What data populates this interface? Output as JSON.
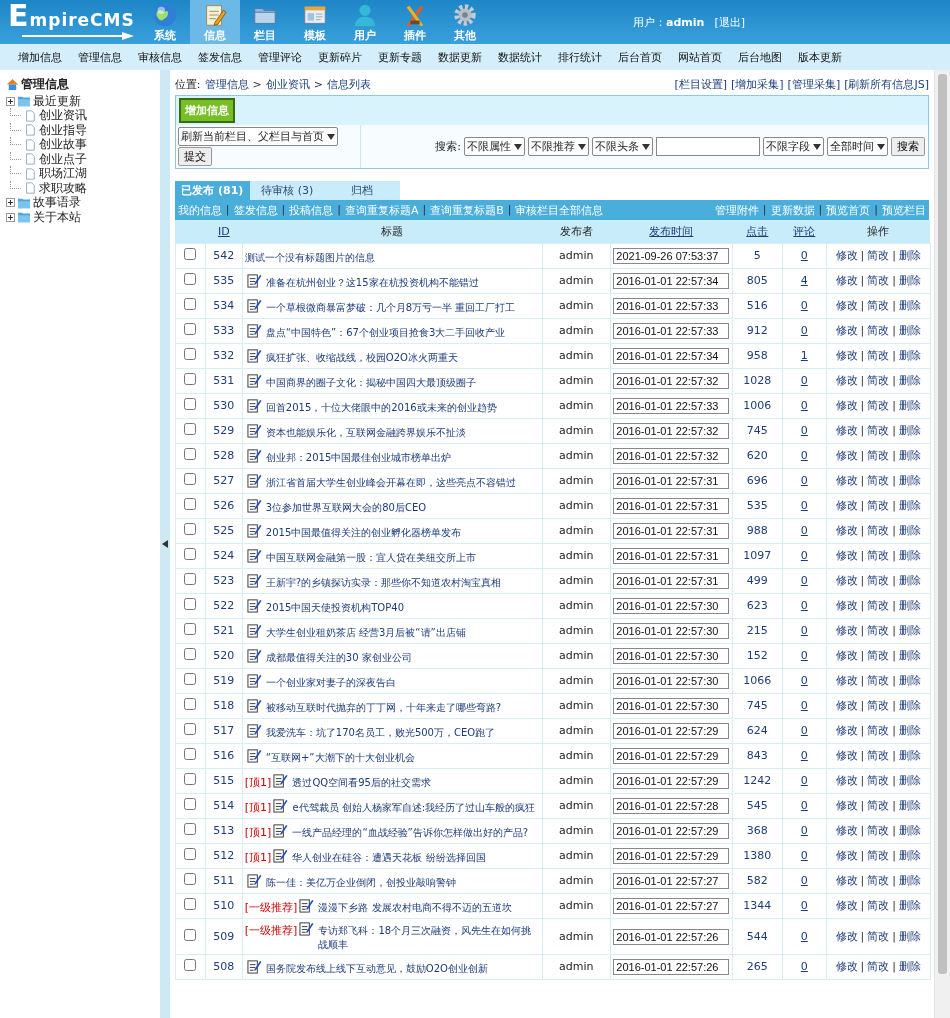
{
  "header": {
    "logo": "EmpireCMS",
    "nav": [
      {
        "kind": "globe",
        "label": "系统",
        "selected": false
      },
      {
        "kind": "notepad",
        "label": "信息",
        "selected": true
      },
      {
        "kind": "folder",
        "label": "栏目",
        "selected": false
      },
      {
        "kind": "window",
        "label": "模板",
        "selected": false
      },
      {
        "kind": "person",
        "label": "用户",
        "selected": false
      },
      {
        "kind": "tools",
        "label": "插件",
        "selected": false
      },
      {
        "kind": "gear",
        "label": "其他",
        "selected": false
      }
    ],
    "user_label": "用户：",
    "user_name": "admin",
    "logout": "[退出]"
  },
  "menu": [
    "增加信息",
    "管理信息",
    "审核信息",
    "签发信息",
    "管理评论",
    "更新碎片",
    "更新专题",
    "数据更新",
    "数据统计",
    "排行统计",
    "后台首页",
    "网站首页",
    "后台地图",
    "版本更新"
  ],
  "sidebar": {
    "root": "管理信息",
    "items": [
      {
        "kind": "folder",
        "label": "最近更新"
      },
      {
        "kind": "page",
        "label": "创业资讯"
      },
      {
        "kind": "page",
        "label": "创业指导"
      },
      {
        "kind": "page",
        "label": "创业故事"
      },
      {
        "kind": "page",
        "label": "创业点子"
      },
      {
        "kind": "page",
        "label": "职场江湖"
      },
      {
        "kind": "page",
        "label": "求职攻略"
      },
      {
        "kind": "folder",
        "label": "故事语录"
      },
      {
        "kind": "folder",
        "label": "关于本站"
      }
    ]
  },
  "breadcrumb": {
    "label": "位置:",
    "separator": ">",
    "items": [
      "管理信息",
      "创业资讯",
      "信息列表"
    ]
  },
  "top_links": [
    "[栏目设置]",
    "[增加采集]",
    "[管理采集]",
    "[刷新所有信息JS]"
  ],
  "add_button": "增加信息",
  "refresh_select": "刷新当前栏目、父栏目与首页",
  "submit_button": "提交",
  "search": {
    "label": "搜索:",
    "filters": [
      "不限属性",
      "不限推荐",
      "不限头条"
    ],
    "field_filters": [
      "不限字段",
      "全部时间"
    ],
    "button": "搜索"
  },
  "tabs": [
    {
      "label": "已发布 (81)",
      "selected": true
    },
    {
      "label": "待审核 (3)",
      "selected": false
    },
    {
      "label": "归档",
      "selected": false
    }
  ],
  "link_bar": {
    "separator": "|",
    "left": [
      "我的信息",
      "签发信息",
      "投稿信息",
      "查询重复标题A",
      "查询重复标题B",
      "审核栏目全部信息"
    ],
    "right": [
      "管理附件",
      "更新数据",
      "预览首页",
      "预览栏目"
    ]
  },
  "table": {
    "columns": [
      {
        "label": "ID",
        "sortable": true
      },
      {
        "label": "标题",
        "sortable": false
      },
      {
        "label": "发布者",
        "sortable": false
      },
      {
        "label": "发布时间",
        "sortable": true
      },
      {
        "label": "点击",
        "sortable": true
      },
      {
        "label": "评论",
        "sortable": true
      },
      {
        "label": "操作",
        "sortable": false
      }
    ],
    "action_separator": "|",
    "rows": [
      {
        "checked": false,
        "id": "542",
        "title_icon": false,
        "title": "测试一个没有标题图片的信息",
        "author": "admin",
        "time": "2021-09-26 07:53:37",
        "clicks": "5",
        "comments": "0",
        "actions": [
          "修改",
          "简改",
          "删除"
        ]
      },
      {
        "checked": false,
        "id": "535",
        "title_icon": true,
        "title": "准备在杭州创业？这15家在杭投资机构不能错过",
        "author": "admin",
        "time": "2016-01-01 22:57:34",
        "clicks": "805",
        "comments": "4",
        "actions": [
          "修改",
          "简改",
          "删除"
        ]
      },
      {
        "checked": false,
        "id": "534",
        "title_icon": true,
        "title": "一个草根微商暴富梦破：几个月8万亏一半 重回工厂打工",
        "author": "admin",
        "time": "2016-01-01 22:57:33",
        "clicks": "516",
        "comments": "0",
        "actions": [
          "修改",
          "简改",
          "删除"
        ]
      },
      {
        "checked": false,
        "id": "533",
        "title_icon": true,
        "title": "盘点“中国特色”：67个创业项目抢食3大二手回收产业",
        "author": "admin",
        "time": "2016-01-01 22:57:33",
        "clicks": "912",
        "comments": "0",
        "actions": [
          "修改",
          "简改",
          "删除"
        ]
      },
      {
        "checked": false,
        "id": "532",
        "title_icon": true,
        "title": "疯狂扩张、收缩战线，校园O2O冰火两重天",
        "author": "admin",
        "time": "2016-01-01 22:57:34",
        "clicks": "958",
        "comments": "1",
        "actions": [
          "修改",
          "简改",
          "删除"
        ]
      },
      {
        "checked": false,
        "id": "531",
        "title_icon": true,
        "title": "中国商界的圈子文化：揭秘中国四大最顶级圈子",
        "author": "admin",
        "time": "2016-01-01 22:57:32",
        "clicks": "1028",
        "comments": "0",
        "actions": [
          "修改",
          "简改",
          "删除"
        ]
      },
      {
        "checked": false,
        "id": "530",
        "title_icon": true,
        "title": "回首2015，十位大佬眼中的2016或未来的创业趋势",
        "author": "admin",
        "time": "2016-01-01 22:57:33",
        "clicks": "1006",
        "comments": "0",
        "actions": [
          "修改",
          "简改",
          "删除"
        ]
      },
      {
        "checked": false,
        "id": "529",
        "title_icon": true,
        "title": "资本也能娱乐化，互联网金融跨界娱乐不扯淡",
        "author": "admin",
        "time": "2016-01-01 22:57:32",
        "clicks": "745",
        "comments": "0",
        "actions": [
          "修改",
          "简改",
          "删除"
        ]
      },
      {
        "checked": false,
        "id": "528",
        "title_icon": true,
        "title": "创业邦：2015中国最佳创业城市榜单出炉",
        "author": "admin",
        "time": "2016-01-01 22:57:32",
        "clicks": "620",
        "comments": "0",
        "actions": [
          "修改",
          "简改",
          "删除"
        ]
      },
      {
        "checked": false,
        "id": "527",
        "title_icon": true,
        "title": "浙江省首届大学生创业峰会开幕在即，这些亮点不容错过",
        "author": "admin",
        "time": "2016-01-01 22:57:31",
        "clicks": "696",
        "comments": "0",
        "actions": [
          "修改",
          "简改",
          "删除"
        ]
      },
      {
        "checked": false,
        "id": "526",
        "title_icon": true,
        "title": "3位参加世界互联网大会的80后CEO",
        "author": "admin",
        "time": "2016-01-01 22:57:31",
        "clicks": "535",
        "comments": "0",
        "actions": [
          "修改",
          "简改",
          "删除"
        ]
      },
      {
        "checked": false,
        "id": "525",
        "title_icon": true,
        "title": "2015中国最值得关注的创业孵化器榜单发布",
        "author": "admin",
        "time": "2016-01-01 22:57:31",
        "clicks": "988",
        "comments": "0",
        "actions": [
          "修改",
          "简改",
          "删除"
        ]
      },
      {
        "checked": false,
        "id": "524",
        "title_icon": true,
        "title": "中国互联网金融第一股：宜人贷在美纽交所上市",
        "author": "admin",
        "time": "2016-01-01 22:57:31",
        "clicks": "1097",
        "comments": "0",
        "actions": [
          "修改",
          "简改",
          "删除"
        ]
      },
      {
        "checked": false,
        "id": "523",
        "title_icon": true,
        "title": "王新宇?的乡镇探访实录：那些你不知道农村淘宝真相",
        "author": "admin",
        "time": "2016-01-01 22:57:31",
        "clicks": "499",
        "comments": "0",
        "actions": [
          "修改",
          "简改",
          "删除"
        ]
      },
      {
        "checked": false,
        "id": "522",
        "title_icon": true,
        "title": "2015中国天使投资机构TOP40",
        "author": "admin",
        "time": "2016-01-01 22:57:30",
        "clicks": "623",
        "comments": "0",
        "actions": [
          "修改",
          "简改",
          "删除"
        ]
      },
      {
        "checked": false,
        "id": "521",
        "title_icon": true,
        "title": "大学生创业租奶茶店 经营3月后被“请”出店铺",
        "author": "admin",
        "time": "2016-01-01 22:57:30",
        "clicks": "215",
        "comments": "0",
        "actions": [
          "修改",
          "简改",
          "删除"
        ]
      },
      {
        "checked": false,
        "id": "520",
        "title_icon": true,
        "title": "成都最值得关注的30 家创业公司",
        "author": "admin",
        "time": "2016-01-01 22:57:30",
        "clicks": "152",
        "comments": "0",
        "actions": [
          "修改",
          "简改",
          "删除"
        ]
      },
      {
        "checked": false,
        "id": "519",
        "title_icon": true,
        "title": "一个创业家对妻子的深夜告白",
        "author": "admin",
        "time": "2016-01-01 22:57:30",
        "clicks": "1066",
        "comments": "0",
        "actions": [
          "修改",
          "简改",
          "删除"
        ]
      },
      {
        "checked": false,
        "id": "518",
        "title_icon": true,
        "title": "被移动互联时代抛弃的丁丁网，十年来走了哪些弯路?",
        "author": "admin",
        "time": "2016-01-01 22:57:30",
        "clicks": "745",
        "comments": "0",
        "actions": [
          "修改",
          "简改",
          "删除"
        ]
      },
      {
        "checked": false,
        "id": "517",
        "title_icon": true,
        "title": "我爱洗车：坑了170名员工，败光500万，CEO跑了",
        "author": "admin",
        "time": "2016-01-01 22:57:29",
        "clicks": "624",
        "comments": "0",
        "actions": [
          "修改",
          "简改",
          "删除"
        ]
      },
      {
        "checked": false,
        "id": "516",
        "title_icon": true,
        "title": "“互联网+”大潮下的十大创业机会",
        "author": "admin",
        "time": "2016-01-01 22:57:29",
        "clicks": "843",
        "comments": "0",
        "actions": [
          "修改",
          "简改",
          "删除"
        ]
      },
      {
        "checked": false,
        "id": "515",
        "tag": "[顶1]",
        "title_icon": true,
        "title": "透过QQ空间看95后的社交需求",
        "author": "admin",
        "time": "2016-01-01 22:57:29",
        "clicks": "1242",
        "comments": "0",
        "actions": [
          "修改",
          "简改",
          "删除"
        ]
      },
      {
        "checked": false,
        "id": "514",
        "tag": "[顶1]",
        "title_icon": true,
        "title": "e代驾裁员 创始人杨家军自述:我经历了过山车般的疯狂",
        "author": "admin",
        "time": "2016-01-01 22:57:28",
        "clicks": "545",
        "comments": "0",
        "actions": [
          "修改",
          "简改",
          "删除"
        ]
      },
      {
        "checked": false,
        "id": "513",
        "tag": "[顶1]",
        "title_icon": true,
        "title": "一线产品经理的“血战经验”告诉你怎样做出好的产品?",
        "author": "admin",
        "time": "2016-01-01 22:57:29",
        "clicks": "368",
        "comments": "0",
        "actions": [
          "修改",
          "简改",
          "删除"
        ]
      },
      {
        "checked": false,
        "id": "512",
        "tag": "[顶1]",
        "title_icon": true,
        "title": "华人创业在硅谷：遭遇天花板 纷纷选择回国",
        "author": "admin",
        "time": "2016-01-01 22:57:29",
        "clicks": "1380",
        "comments": "0",
        "actions": [
          "修改",
          "简改",
          "删除"
        ]
      },
      {
        "checked": false,
        "id": "511",
        "title_icon": true,
        "title": "陈一佳：美亿万企业倒闭，创投业敲响警钟",
        "author": "admin",
        "time": "2016-01-01 22:57:27",
        "clicks": "582",
        "comments": "0",
        "actions": [
          "修改",
          "简改",
          "删除"
        ]
      },
      {
        "checked": false,
        "id": "510",
        "tag": "[一级推荐]",
        "title_icon": true,
        "title": "漫漫下乡路 发展农村电商不得不迈的五道坎",
        "author": "admin",
        "time": "2016-01-01 22:57:27",
        "clicks": "1344",
        "comments": "0",
        "actions": [
          "修改",
          "简改",
          "删除"
        ]
      },
      {
        "checked": false,
        "id": "509",
        "tag": "[一级推荐]",
        "title_icon": true,
        "title": "专访郑飞科：18个月三次融资，风先生在如何挑战顺丰",
        "author": "admin",
        "time": "2016-01-01 22:57:26",
        "clicks": "544",
        "comments": "0",
        "actions": [
          "修改",
          "简改",
          "删除"
        ]
      },
      {
        "checked": false,
        "id": "508",
        "title_icon": true,
        "title": "国务院发布线上线下互动意见，鼓励O2O创业创新",
        "author": "admin",
        "time": "2016-01-01 22:57:26",
        "clicks": "265",
        "comments": "0",
        "actions": [
          "修改",
          "简改",
          "删除"
        ]
      }
    ]
  }
}
